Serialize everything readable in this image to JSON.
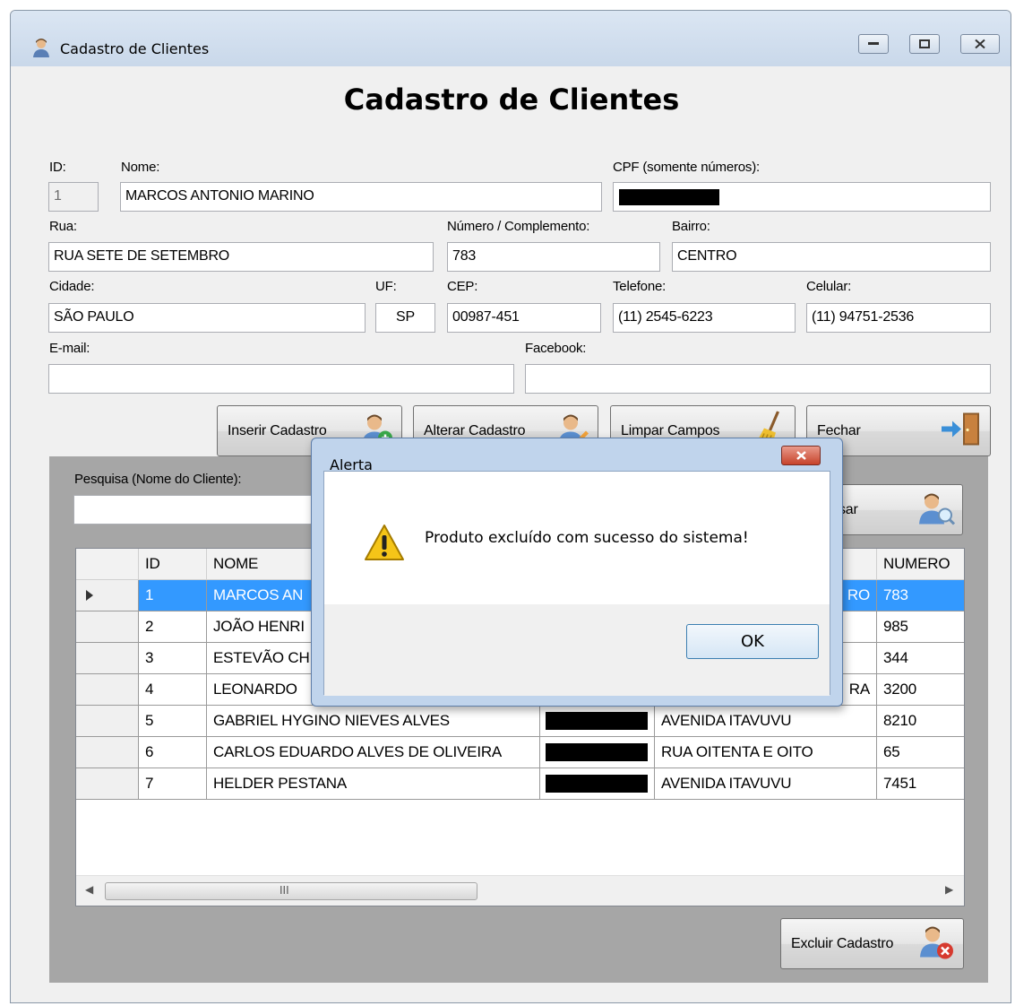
{
  "window": {
    "title": "Cadastro de Clientes"
  },
  "form": {
    "heading": "Cadastro de Clientes",
    "labels": {
      "id": "ID:",
      "nome": "Nome:",
      "cpf": "CPF (somente números):",
      "rua": "Rua:",
      "numero": "Número / Complemento:",
      "bairro": "Bairro:",
      "cidade": "Cidade:",
      "uf": "UF:",
      "cep": "CEP:",
      "telefone": "Telefone:",
      "celular": "Celular:",
      "email": "E-mail:",
      "facebook": "Facebook:"
    },
    "values": {
      "id": "1",
      "nome": "MARCOS ANTONIO MARINO",
      "cpf": "",
      "rua": "RUA SETE DE SETEMBRO",
      "numero": "783",
      "bairro": "CENTRO",
      "cidade": "SÃO PAULO",
      "uf": "SP",
      "cep": "00987-451",
      "telefone": "(11) 2545-6223",
      "celular": "(11) 94751-2536",
      "email": "",
      "facebook": ""
    }
  },
  "buttons": {
    "inserir": "Inserir Cadastro",
    "alterar": "Alterar Cadastro",
    "limpar": "Limpar Campos",
    "fechar": "Fechar",
    "pesquisar_partial": "sar",
    "excluir": "Excluir Cadastro"
  },
  "search": {
    "label": "Pesquisa (Nome do Cliente):",
    "value": ""
  },
  "grid": {
    "columns": [
      "ID",
      "NOME",
      "",
      "",
      "NUMERO"
    ],
    "rows": [
      {
        "id": "1",
        "nome": "MARCOS AN",
        "rua": "RO",
        "numero": "783"
      },
      {
        "id": "2",
        "nome": "JOÃO HENRI",
        "rua": "",
        "numero": "985"
      },
      {
        "id": "3",
        "nome": "ESTEVÃO CH",
        "rua": "",
        "numero": "344"
      },
      {
        "id": "4",
        "nome": "LEONARDO",
        "rua": "RA",
        "numero": "3200"
      },
      {
        "id": "5",
        "nome": "GABRIEL HYGINO NIEVES ALVES",
        "rua": "AVENIDA ITAVUVU",
        "numero": "8210"
      },
      {
        "id": "6",
        "nome": "CARLOS EDUARDO ALVES DE OLIVEIRA",
        "rua": "RUA OITENTA E OITO",
        "numero": "65"
      },
      {
        "id": "7",
        "nome": "HELDER PESTANA",
        "rua": "AVENIDA ITAVUVU",
        "numero": "7451"
      }
    ],
    "scroll_thumb_glyph": "III"
  },
  "dialog": {
    "title": "Alerta",
    "message": "Produto excluído com sucesso do sistema!",
    "ok_label": "OK"
  }
}
